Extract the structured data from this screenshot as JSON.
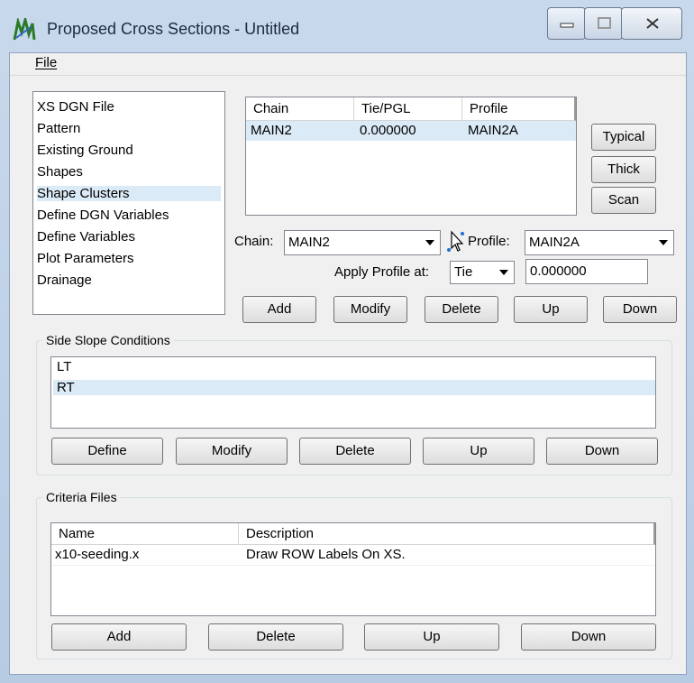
{
  "window": {
    "title": "Proposed Cross Sections - Untitled",
    "menu_file": "File"
  },
  "nav_list": {
    "items": [
      "XS DGN File",
      "Pattern",
      "Existing Ground",
      "Shapes",
      "Shape Clusters",
      "Define DGN Variables",
      "Define Variables",
      "Plot Parameters",
      "Drainage"
    ],
    "selected_index": 4
  },
  "chain_table": {
    "headers": [
      "Chain",
      "Tie/PGL",
      "Profile"
    ],
    "rows": [
      [
        "MAIN2",
        "0.000000",
        "MAIN2A"
      ]
    ]
  },
  "side_buttons": {
    "typical": "Typical",
    "thick": "Thick",
    "scan": "Scan"
  },
  "chain_controls": {
    "chain_label": "Chain:",
    "chain_value": "MAIN2",
    "profile_label": "Profile:",
    "profile_value": "MAIN2A",
    "apply_label": "Apply Profile at:",
    "apply_value": "Tie",
    "apply_number": "0.000000"
  },
  "chain_buttons": {
    "add": "Add",
    "modify": "Modify",
    "delete": "Delete",
    "up": "Up",
    "down": "Down"
  },
  "side_slope": {
    "label": "Side Slope Conditions",
    "items": [
      "LT",
      "RT"
    ],
    "selected_index": 1,
    "buttons": {
      "define": "Define",
      "modify": "Modify",
      "delete": "Delete",
      "up": "Up",
      "down": "Down"
    }
  },
  "criteria": {
    "label": "Criteria Files",
    "headers": [
      "Name",
      "Description"
    ],
    "rows": [
      [
        "x10-seeding.x",
        "Draw ROW Labels On XS."
      ]
    ],
    "buttons": {
      "add": "Add",
      "delete": "Delete",
      "up": "Up",
      "down": "Down"
    }
  },
  "colors": {
    "selection": "#dbeaf7",
    "window_bg": "#f0f0f0",
    "title_bar": "#c9d9ec"
  }
}
